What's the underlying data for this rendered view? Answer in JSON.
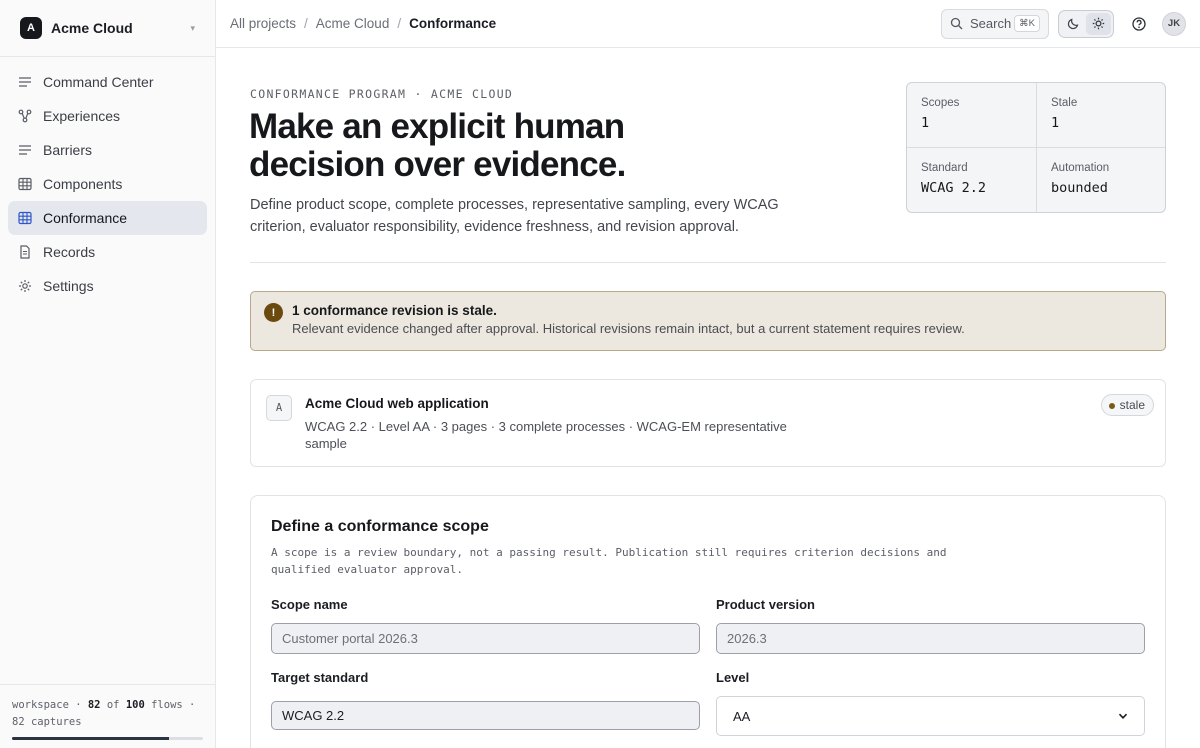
{
  "workspace": {
    "initial": "A",
    "name": "Acme Cloud"
  },
  "sidebar": {
    "items": [
      {
        "label": "Command Center",
        "icon": "lines-icon",
        "active": false
      },
      {
        "label": "Experiences",
        "icon": "nodes-icon",
        "active": false
      },
      {
        "label": "Barriers",
        "icon": "lines-icon",
        "active": false
      },
      {
        "label": "Components",
        "icon": "grid-icon",
        "active": false
      },
      {
        "label": "Conformance",
        "icon": "grid-icon",
        "active": true
      },
      {
        "label": "Records",
        "icon": "document-icon",
        "active": false
      },
      {
        "label": "Settings",
        "icon": "gear-icon",
        "active": false
      }
    ],
    "footer": {
      "prefix": "workspace · ",
      "used": "82",
      "middle": " of ",
      "total": "100",
      "suffix": " flows · 82 captures",
      "usage_fraction": 0.82
    }
  },
  "topbar": {
    "breadcrumbs": [
      "All projects",
      "Acme Cloud",
      "Conformance"
    ],
    "search_label": "Search",
    "search_shortcut": "⌘K",
    "avatar_initials": "JK"
  },
  "hero": {
    "eyebrow": "CONFORMANCE PROGRAM · ACME CLOUD",
    "title": "Make an explicit human decision over evidence.",
    "subtitle": "Define product scope, complete processes, representative sampling, every WCAG criterion, evaluator responsibility, evidence freshness, and revision approval."
  },
  "stats": [
    {
      "label": "Scopes",
      "value": "1"
    },
    {
      "label": "Stale",
      "value": "1"
    },
    {
      "label": "Standard",
      "value": "WCAG 2.2"
    },
    {
      "label": "Automation",
      "value": "bounded"
    }
  ],
  "alert": {
    "icon": "!",
    "title": "1 conformance revision is stale.",
    "body": "Relevant evidence changed after approval. Historical revisions remain intact, but a current statement requires review."
  },
  "scope_card": {
    "letter": "A",
    "title": "Acme Cloud web application",
    "meta": "WCAG 2.2 · Level AA · 3 pages · 3 complete processes · WCAG-EM representative sample",
    "status": "stale"
  },
  "form": {
    "title": "Define a conformance scope",
    "help": "A scope is a review boundary, not a passing result. Publication still requires criterion decisions and qualified evaluator approval.",
    "scope_name": {
      "label": "Scope name",
      "placeholder": "Customer portal 2026.3"
    },
    "product_version": {
      "label": "Product version",
      "placeholder": "2026.3"
    },
    "target_standard": {
      "label": "Target standard",
      "value": "WCAG 2.2"
    },
    "level": {
      "label": "Level",
      "value": "AA"
    }
  },
  "colors": {
    "accent": "#2c3340",
    "alert_bg": "#ede8df",
    "alert_border": "#b9a88a",
    "stale_dot": "#7a5a15"
  }
}
